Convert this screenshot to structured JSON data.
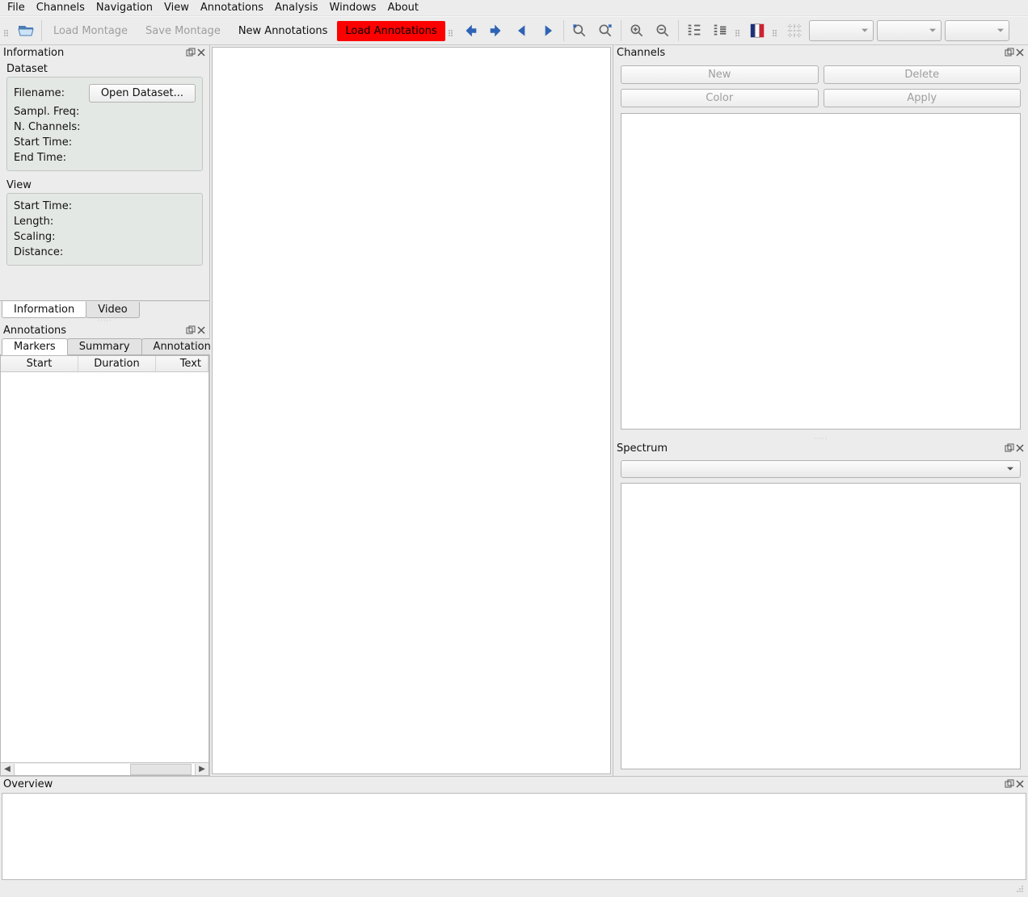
{
  "menu": [
    "File",
    "Channels",
    "Navigation",
    "View",
    "Annotations",
    "Analysis",
    "Windows",
    "About"
  ],
  "toolbar": {
    "load_montage": "Load Montage",
    "save_montage": "Save Montage",
    "new_annotations": "New Annotations",
    "load_annotations": "Load Annotations"
  },
  "panels": {
    "information": "Information",
    "annotations": "Annotations",
    "channels": "Channels",
    "spectrum": "Spectrum",
    "overview": "Overview"
  },
  "dataset": {
    "label": "Dataset",
    "filename": "Filename:",
    "open_btn": "Open Dataset...",
    "sampl": "Sampl. Freq:",
    "nchan": "N. Channels:",
    "start": "Start Time:",
    "end": "End Time:"
  },
  "view": {
    "label": "View",
    "start": "Start Time:",
    "length": "Length:",
    "scaling": "Scaling:",
    "distance": "Distance:"
  },
  "info_tabs": {
    "information": "Information",
    "video": "Video"
  },
  "ann_tabs": {
    "markers": "Markers",
    "summary": "Summary",
    "annotations": "Annotations"
  },
  "table_headers": {
    "start": "Start",
    "duration": "Duration",
    "text": "Text"
  },
  "channels_btns": {
    "new": "New",
    "delete": "Delete",
    "color": "Color",
    "apply": "Apply"
  }
}
